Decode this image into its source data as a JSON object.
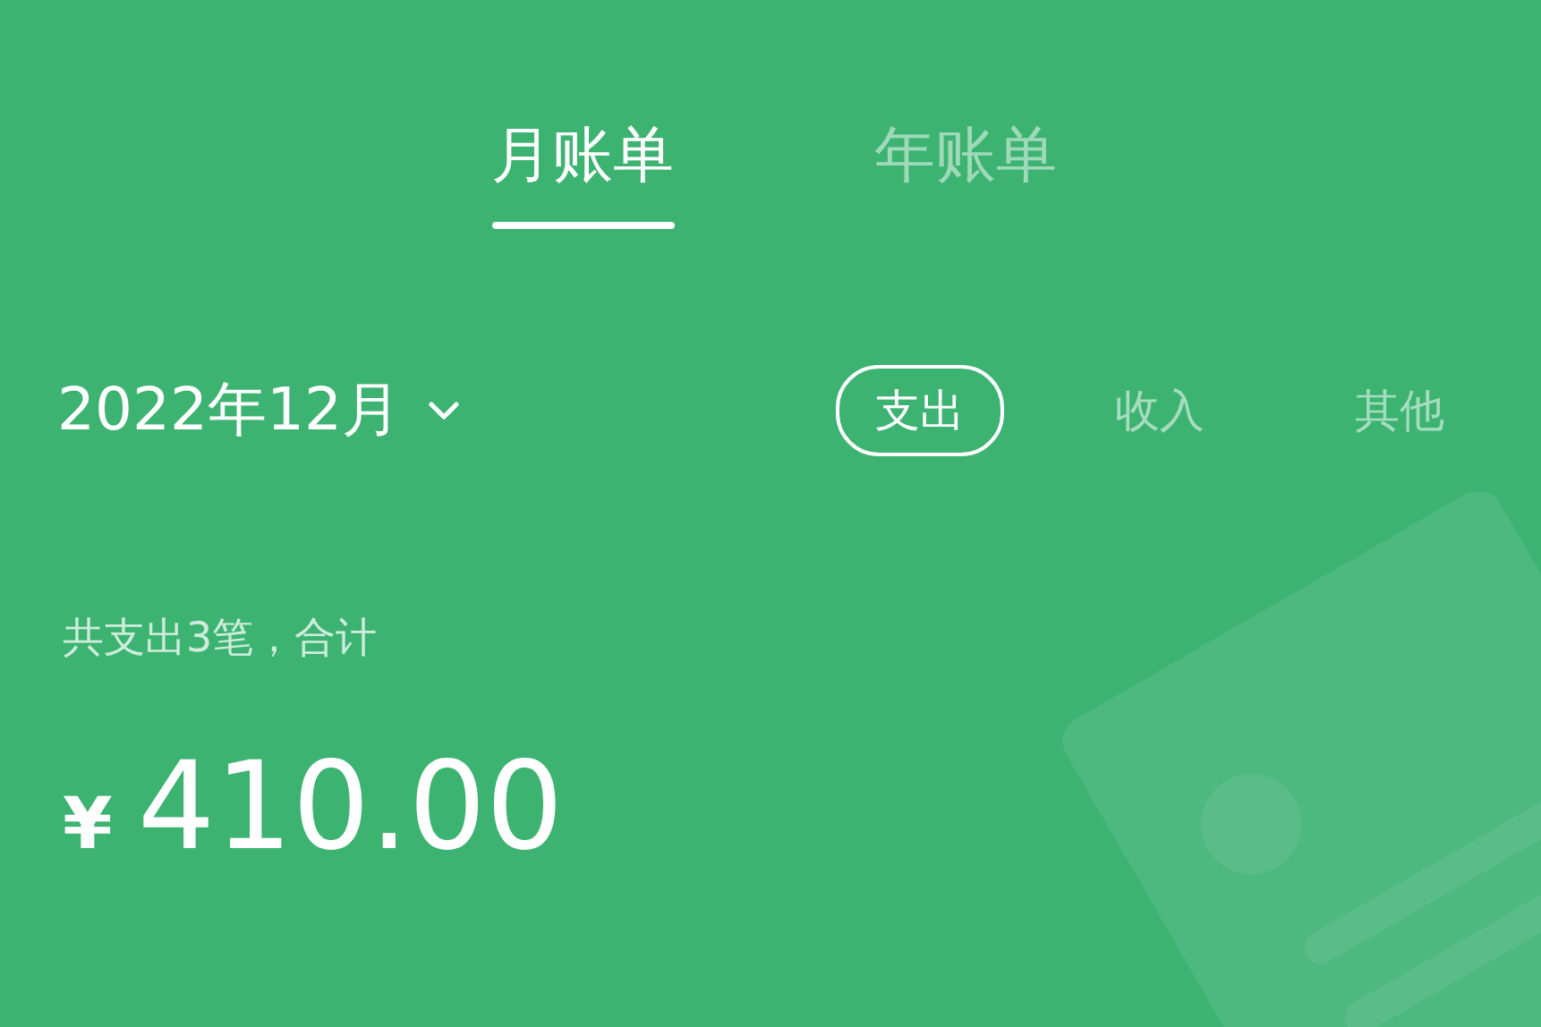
{
  "tabs": [
    {
      "label": "月账单",
      "selected": true
    },
    {
      "label": "年账单",
      "selected": false
    }
  ],
  "month_picker": {
    "label": "2022年12月"
  },
  "filters": [
    {
      "label": "支出",
      "selected": true
    },
    {
      "label": "收入",
      "selected": false
    },
    {
      "label": "其他",
      "selected": false
    }
  ],
  "summary": {
    "text": "共支出3笔，合计",
    "currency": "¥",
    "amount": "410.00"
  }
}
